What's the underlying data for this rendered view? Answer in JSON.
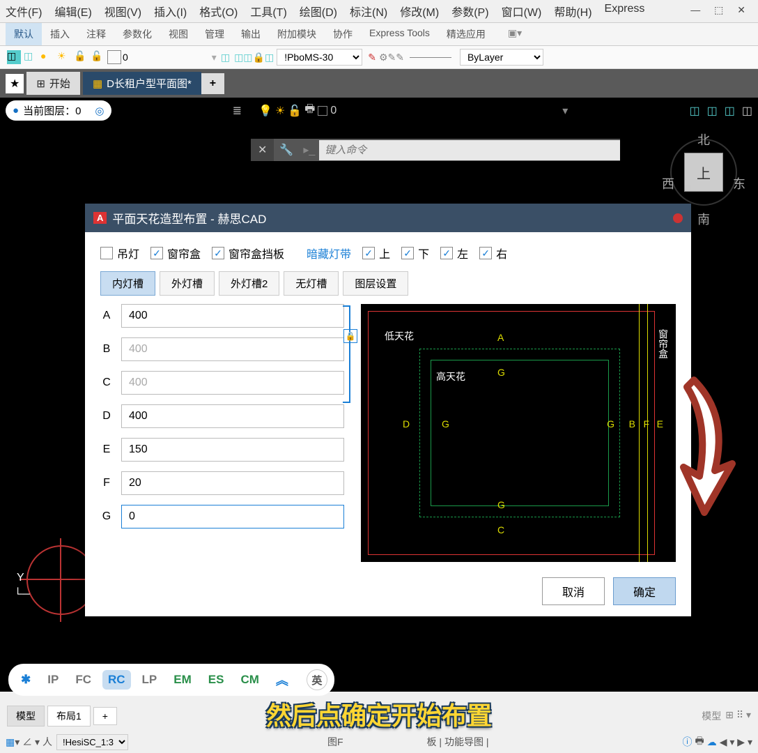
{
  "menu": {
    "file": "文件(F)",
    "edit": "编辑(E)",
    "view": "视图(V)",
    "insert": "插入(I)",
    "format": "格式(O)",
    "tools": "工具(T)",
    "draw": "绘图(D)",
    "annotate": "标注(N)",
    "modify": "修改(M)",
    "params": "参数(P)",
    "window": "窗口(W)",
    "help": "帮助(H)",
    "express": "Express"
  },
  "ribbon": {
    "t1": "默认",
    "t2": "插入",
    "t3": "注释",
    "t4": "参数化",
    "t5": "视图",
    "t6": "管理",
    "t7": "输出",
    "t8": "附加模块",
    "t9": "协作",
    "t10": "Express Tools",
    "t11": "精选应用"
  },
  "toolbar": {
    "zero": "0",
    "linetype": "!PboMS-30",
    "bylayer": "ByLayer"
  },
  "tabs": {
    "start": "开始",
    "doc": "D长租户型平面图*"
  },
  "layerbar": {
    "current": "当前图层：0",
    "zero": "0"
  },
  "cmd": {
    "placeholder": "键入命令"
  },
  "cube": {
    "n": "北",
    "s": "南",
    "e": "东",
    "w": "西",
    "top": "上"
  },
  "dialog": {
    "title": "平面天花造型布置 - 赫思CAD",
    "chk": {
      "diaodeng": "吊灯",
      "chuanglianhе": "窗帘盒",
      "dangban": "窗帘盒挡板",
      "dengdai": "暗藏灯带",
      "up": "上",
      "down": "下",
      "left": "左",
      "right": "右"
    },
    "subtabs": {
      "t1": "内灯槽",
      "t2": "外灯槽",
      "t3": "外灯槽2",
      "t4": "无灯槽",
      "t5": "图层设置"
    },
    "labels": {
      "A": "A",
      "B": "B",
      "C": "C",
      "D": "D",
      "E": "E",
      "F": "F",
      "G": "G"
    },
    "values": {
      "A": "400",
      "B": "400",
      "C": "400",
      "D": "400",
      "E": "150",
      "F": "20",
      "G": "0"
    },
    "preview": {
      "ditianhua": "低天花",
      "gaotianhua": "高天花",
      "chuanglianhе": "窗帘盒",
      "A": "A",
      "B": "B",
      "C": "C",
      "D": "D",
      "E": "E",
      "F": "F",
      "G": "G"
    },
    "cancel": "取消",
    "ok": "确定"
  },
  "pill": {
    "ip": "IP",
    "fc": "FC",
    "rc": "RC",
    "lp": "LP",
    "em": "EM",
    "es": "ES",
    "cm": "CM",
    "ime": "英"
  },
  "bottom": {
    "model": "模型",
    "layout1": "布局1",
    "plus": "+",
    "model2": "模型"
  },
  "status": {
    "style": "!HesiSC_1:3",
    "note1": "图F",
    "note2": "板 | 功能导图 |"
  },
  "caption": "然后点确定开始布置"
}
